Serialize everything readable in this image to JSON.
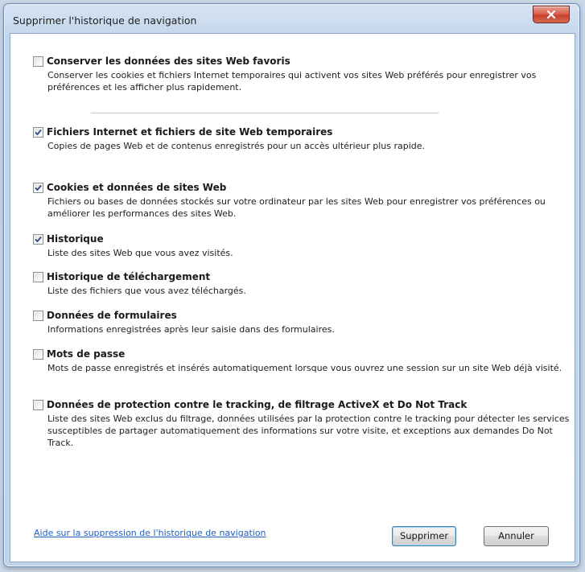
{
  "window": {
    "title": "Supprimer l'historique de navigation"
  },
  "options": [
    {
      "title": "Conserver les données des sites Web favoris",
      "description": "Conserver les cookies et fichiers Internet temporaires qui activent vos sites Web préférés pour enregistrer vos préférences et les afficher plus rapidement.",
      "checked": false
    },
    {
      "title": "Fichiers Internet et fichiers de site Web temporaires",
      "description": "Copies de pages Web et de contenus enregistrés pour un accès ultérieur plus rapide.",
      "checked": true
    },
    {
      "title": "Cookies et données de sites Web",
      "description": "Fichiers ou bases de données stockés sur votre ordinateur par les sites Web pour enregistrer vos préférences ou améliorer les performances des sites Web.",
      "checked": true
    },
    {
      "title": "Historique",
      "description": "Liste des sites Web que vous avez visités.",
      "checked": true
    },
    {
      "title": "Historique de téléchargement",
      "description": "Liste des fichiers que vous avez téléchargés.",
      "checked": false
    },
    {
      "title": "Données de formulaires",
      "description": "Informations enregistrées après leur saisie dans des formulaires.",
      "checked": false
    },
    {
      "title": "Mots de passe",
      "description": "Mots de passe enregistrés et insérés automatiquement lorsque vous ouvrez une session sur un site Web déjà visité.",
      "checked": false
    },
    {
      "title": "Données de protection contre le tracking, de filtrage ActiveX et Do Not Track",
      "description": "Liste des sites Web exclus du filtrage, données utilisées par la protection contre le tracking pour détecter les services susceptibles de partager automatiquement des informations sur votre visite, et exceptions aux demandes Do Not Track.",
      "checked": false
    }
  ],
  "footer": {
    "help_link": "Aide sur la suppression de l'historique de navigation",
    "delete_label": "Supprimer",
    "cancel_label": "Annuler"
  },
  "icons": {
    "close": "close-icon",
    "checkmark": "checkmark-icon"
  },
  "colors": {
    "link": "#1e5fbf",
    "close_button": "#c7412c",
    "window_frame": "#bed2ea"
  }
}
